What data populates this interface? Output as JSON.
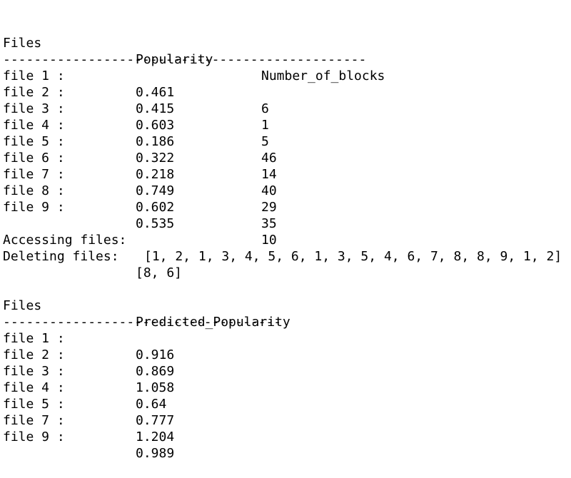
{
  "table1": {
    "headers": [
      "Files",
      "Popularity",
      "Number_of_blocks"
    ],
    "separator": "-----------------------------------------------",
    "rows": [
      {
        "file": "file 1 :",
        "popularity": "0.461",
        "blocks": "6"
      },
      {
        "file": "file 2 :",
        "popularity": "0.415",
        "blocks": "1"
      },
      {
        "file": "file 3 :",
        "popularity": "0.603",
        "blocks": "5"
      },
      {
        "file": "file 4 :",
        "popularity": "0.186",
        "blocks": "46"
      },
      {
        "file": "file 5 :",
        "popularity": "0.322",
        "blocks": "14"
      },
      {
        "file": "file 6 :",
        "popularity": "0.218",
        "blocks": "40"
      },
      {
        "file": "file 7 :",
        "popularity": "0.749",
        "blocks": "29"
      },
      {
        "file": "file 8 :",
        "popularity": "0.602",
        "blocks": "35"
      },
      {
        "file": "file 9 :",
        "popularity": "0.535",
        "blocks": "10"
      }
    ]
  },
  "accessing": {
    "label": "Accessing files:",
    "value": "[1, 2, 1, 3, 4, 5, 6, 1, 3, 5, 4, 6, 7, 8, 8, 9, 1, 2]"
  },
  "deleting": {
    "label": "Deleting files:",
    "value": "[8, 6]"
  },
  "table2": {
    "headers": [
      "Files",
      "Predicted_Popularity"
    ],
    "separator": "------------------------------------",
    "rows": [
      {
        "file": "file 1 :",
        "predicted": "0.916"
      },
      {
        "file": "file 2 :",
        "predicted": "0.869"
      },
      {
        "file": "file 3 :",
        "predicted": "1.058"
      },
      {
        "file": "file 4 :",
        "predicted": "0.64"
      },
      {
        "file": "file 5 :",
        "predicted": "0.777"
      },
      {
        "file": "file 7 :",
        "predicted": "1.204"
      },
      {
        "file": "file 9 :",
        "predicted": "0.989"
      }
    ]
  }
}
